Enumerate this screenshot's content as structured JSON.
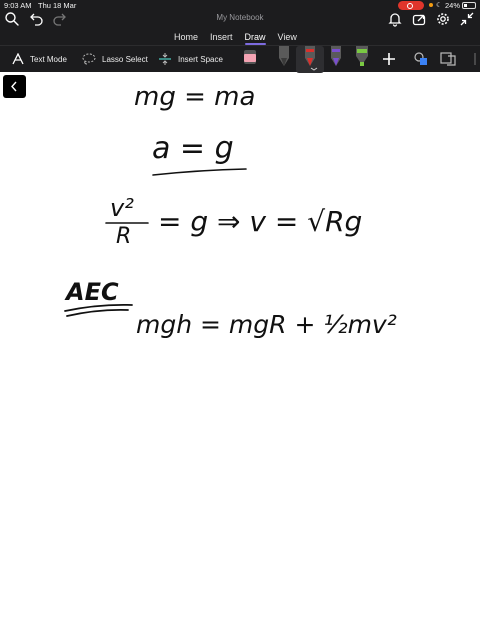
{
  "status_bar": {
    "time": "9:03 AM",
    "date": "Thu 18 Mar",
    "battery_percent": "24%",
    "recording_color": "#e0352b"
  },
  "window": {
    "title": "My Notebook"
  },
  "top_icons": [
    "search-icon",
    "undo-icon",
    "redo-icon",
    "bell-icon",
    "share-icon",
    "gear-icon",
    "collapse-icon"
  ],
  "tabs": [
    {
      "label": "Home",
      "active": false
    },
    {
      "label": "Insert",
      "active": false
    },
    {
      "label": "Draw",
      "active": true
    },
    {
      "label": "View",
      "active": false
    }
  ],
  "toolbar": {
    "text_mode_label": "Text Mode",
    "lasso_select_label": "Lasso Select",
    "insert_space_label": "Insert Space"
  },
  "pens": {
    "eraser_color": "#f4a3b3",
    "pen_black_color": "#3a3a3a",
    "pen_red_color": "#d9302c",
    "pen_purple_color": "#7a4fd0",
    "highlighter_green_color": "#7ac943"
  },
  "accent_color": "#7d6be0",
  "notes": {
    "line1": "mg = ma",
    "line2": "a = g",
    "line3_lhs_num": "v²",
    "line3_lhs_den": "R",
    "line3_rest": "= g  ⇒  v = √Rg",
    "heading": "AEC",
    "line5": "mgh = mgR + ½mv²"
  }
}
